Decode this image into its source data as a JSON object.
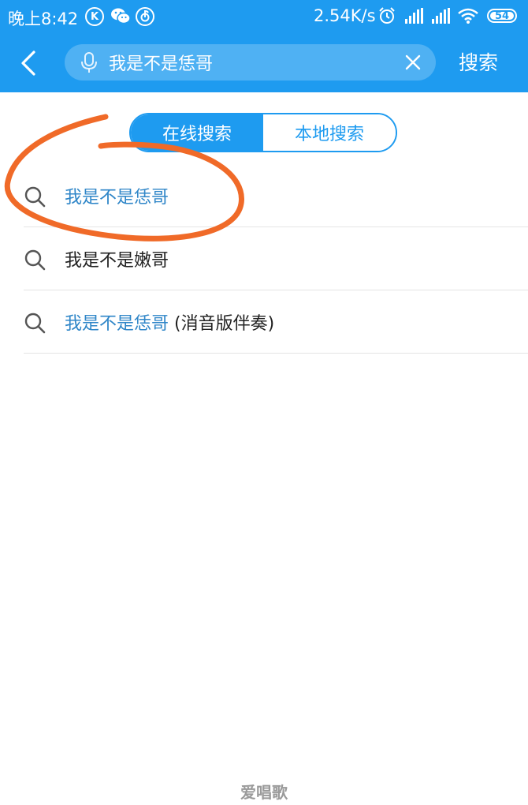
{
  "status_bar": {
    "time": "晚上8:42",
    "k_label": "K",
    "netease_label": "",
    "speed": "2.54K/s",
    "battery": "54"
  },
  "header": {
    "search_value": "我是不是恁哥",
    "search_placeholder": "",
    "search_button_label": "搜索"
  },
  "tabs": [
    {
      "label": "在线搜索",
      "active": true
    },
    {
      "label": "本地搜索",
      "active": false
    }
  ],
  "results": [
    {
      "highlight": "我是不是恁哥",
      "rest": ""
    },
    {
      "highlight": "",
      "rest": "我是不是嫩哥"
    },
    {
      "highlight": "我是不是恁哥",
      "rest": " (消音版伴奏)"
    }
  ],
  "watermark": "爱唱歌",
  "colors": {
    "accent": "#1e9bf0",
    "highlight_text": "#2f86c8",
    "annotation": "#f06a28"
  },
  "icons": {
    "back": "chevron-left-icon",
    "mic": "mic-icon",
    "clear": "close-icon",
    "result": "search-icon"
  }
}
